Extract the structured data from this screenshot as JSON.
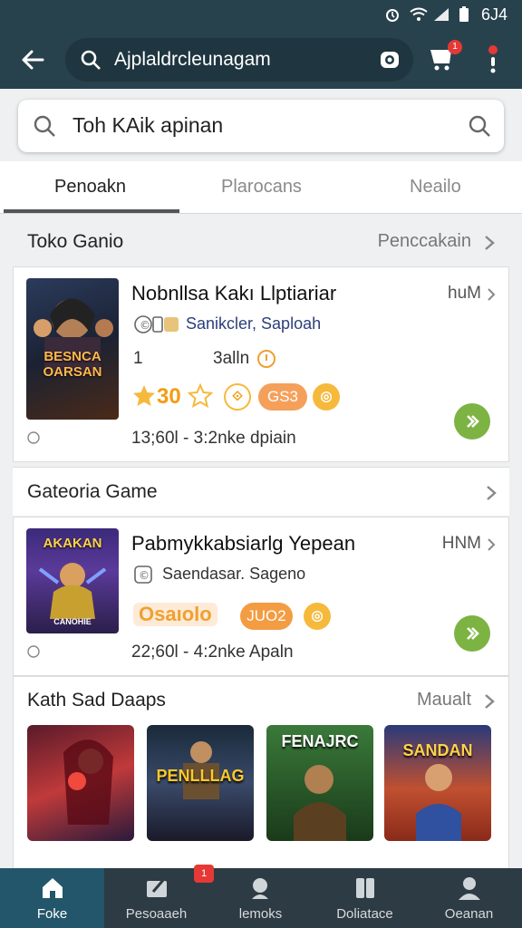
{
  "status_bar": {
    "time": "6J4"
  },
  "app_bar": {
    "query": "Ajplaldrcleunagam",
    "cart_badge": "1"
  },
  "search_card": {
    "text": "Toh KAik apinan"
  },
  "tabs": [
    {
      "label": "Penoakn"
    },
    {
      "label": "Plarocans"
    },
    {
      "label": "Neailo"
    }
  ],
  "section1": {
    "title": "Toko Ganio",
    "link": "Penccakain",
    "item": {
      "cover_text": "BESNCA OARSAN",
      "title": "Nobnllsa Kakı Llptiariar",
      "price": "huM",
      "subtitle": "Sanikcler, Saploah",
      "meta_num": "1",
      "meta_text": "3alln",
      "rating": "30",
      "pill": "GS3",
      "footer": "13;60l - 3:2nke dpiain"
    }
  },
  "section2": {
    "title": "Gateoria Game",
    "item": {
      "cover_text": "AKAKAN",
      "cover_sub": "CANOHIE",
      "title": "Pabmykkabsiarlg Yepean",
      "price": "HNM",
      "subtitle": "Saendasar. Sageno",
      "label_orange": "Osaıolo",
      "pill": "JUO2",
      "footer": "22;60l - 4:2nke Apaln"
    }
  },
  "section3": {
    "title": "Kath Sad Daaps",
    "link": "Maualt",
    "thumbs": [
      {
        "text": ""
      },
      {
        "text": "PENLLLAG"
      },
      {
        "text": "FENAJRC"
      },
      {
        "text": "SANDAN"
      }
    ]
  },
  "bottom_nav": {
    "badge": "1",
    "items": [
      {
        "label": "Foke"
      },
      {
        "label": "Pesoaaeh"
      },
      {
        "label": "lemoks"
      },
      {
        "label": "Doliatace"
      },
      {
        "label": "Oeanan"
      }
    ]
  },
  "colors": {
    "header": "#28424d",
    "accent_green": "#7cb342",
    "star": "#f6b93b",
    "nav_bg": "#2c3b44"
  }
}
